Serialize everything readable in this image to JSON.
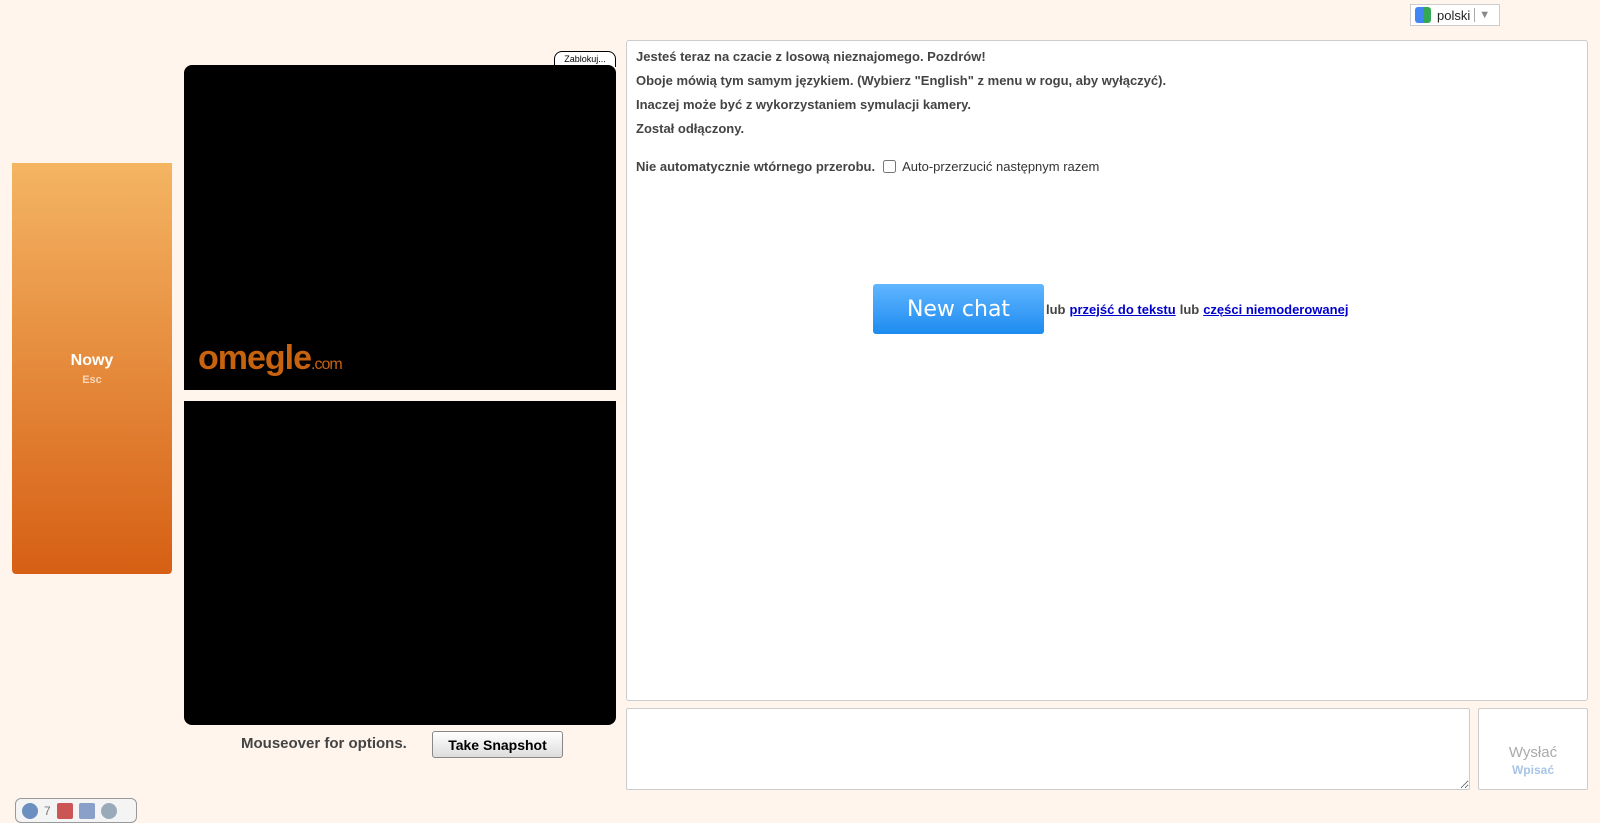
{
  "language": {
    "selected": "polski"
  },
  "sidebar": {
    "new_label": "Nowy",
    "new_shortcut": "Esc"
  },
  "video": {
    "block_label": "Zablokuj...",
    "logo": "omegle",
    "logo_suffix": ".com",
    "mouseover": "Mouseover for options.",
    "snapshot": "Take Snapshot"
  },
  "log": {
    "messages": [
      "Jesteś teraz na czacie z losową nieznajomego. Pozdrów!",
      "Oboje mówią tym samym językiem. (Wybierz \"English\" z menu w rogu, aby wyłączyć).",
      "Inaczej może być z wykorzystaniem symulacji kamery.",
      "Został odłączony."
    ],
    "reconnect_text": "Nie automatycznie wtórnego przerobu.",
    "auto_label": "Auto-przerzucić następnym razem",
    "new_chat": "New chat",
    "or1": "lub",
    "text_link": "przejść do tekstu",
    "or2": "lub",
    "unmod_link": "części niemoderowanej"
  },
  "send": {
    "label": "Wysłać",
    "sub": "Wpisać"
  },
  "bottom_bar": {
    "count": "7"
  }
}
